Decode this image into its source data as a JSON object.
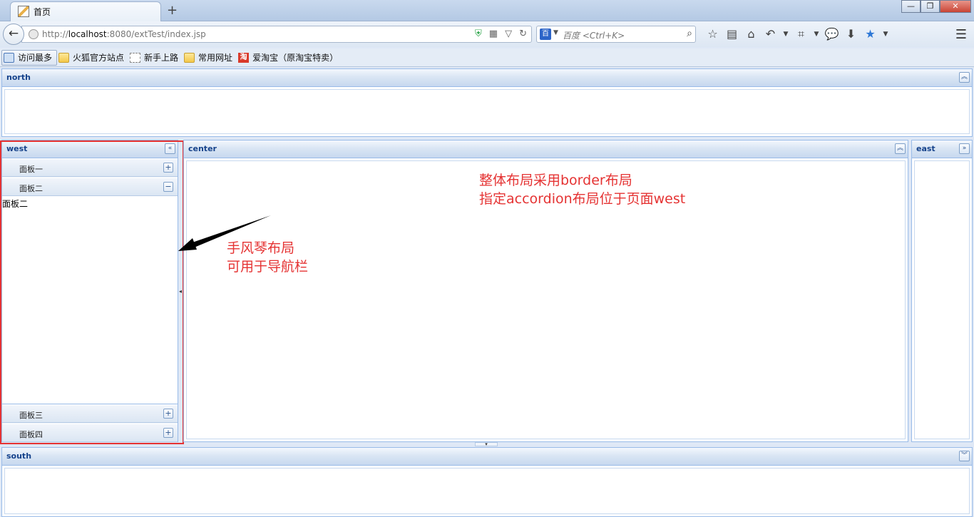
{
  "browser": {
    "tab_title": "首页",
    "new_tab": "+",
    "window_buttons": {
      "minimize": "—",
      "maximize": "❐",
      "close": "✕"
    },
    "url_prefix": "http://",
    "url_host": "localhost",
    "url_rest": ":8080/extTest/index.jsp",
    "search_engine_label": "百",
    "search_placeholder": "百度 <Ctrl+K>",
    "bookmarks": [
      {
        "label": "访问最多",
        "icon": "search-icon"
      },
      {
        "label": "火狐官方站点",
        "icon": "folder-icon"
      },
      {
        "label": "新手上路",
        "icon": "dashed-box-icon"
      },
      {
        "label": "常用网址",
        "icon": "folder-icon"
      },
      {
        "label": "爱淘宝（原淘宝特卖）",
        "icon": "taobao-icon"
      }
    ],
    "taobao_icon_text": "淘"
  },
  "layout": {
    "north": {
      "title": "north",
      "tool": "︽"
    },
    "west": {
      "title": "west",
      "tool": "«",
      "accordion": [
        {
          "title": "面板一",
          "tool": "+"
        },
        {
          "title": "面板二",
          "tool": "−",
          "body": "面板二"
        },
        {
          "title": "面板三",
          "tool": "+"
        },
        {
          "title": "面板四",
          "tool": "+"
        }
      ]
    },
    "center": {
      "title": "center",
      "tool": "︽"
    },
    "east": {
      "title": "east",
      "tool": "»"
    },
    "south": {
      "title": "south",
      "tool": "︾"
    }
  },
  "annotations": {
    "center_note_line1": "整体布局采用border布局",
    "center_note_line2": "指定accordion布局位于页面west",
    "accordion_note_line1": "手风琴布局",
    "accordion_note_line2": "可用于导航栏"
  },
  "colors": {
    "annotation": "#e53333",
    "header_title": "#15428b",
    "panel_border": "#99bbe8"
  }
}
